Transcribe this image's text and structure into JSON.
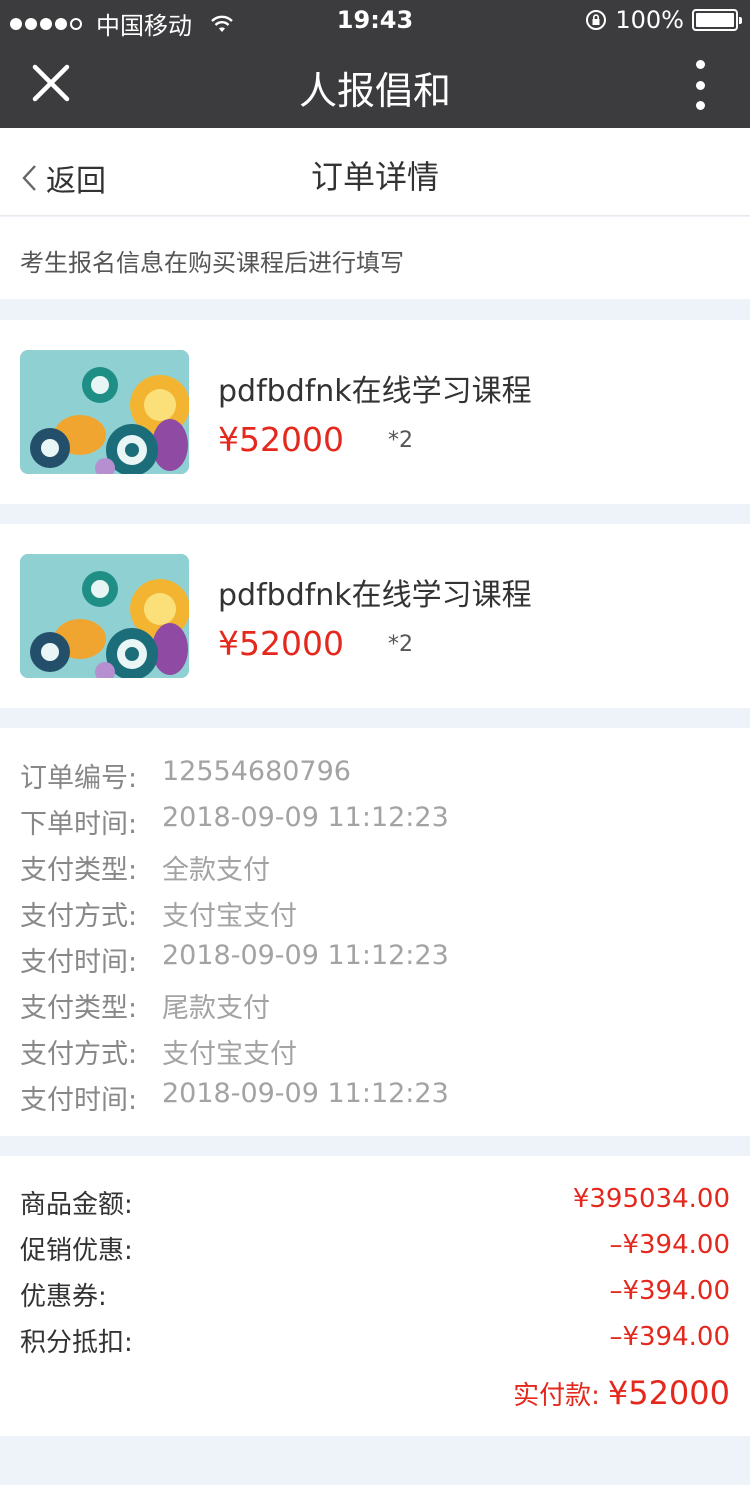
{
  "status_bar": {
    "carrier": "中国移动",
    "time": "19:43",
    "battery": "100%",
    "signal_bars_filled": 4,
    "signal_bars_total": 5
  },
  "title_bar": {
    "title": "人报倡和",
    "close_icon": "close-icon",
    "more_icon": "more-vertical-icon"
  },
  "nav": {
    "back_label": "返回",
    "page_title": "订单详情"
  },
  "notice": "考生报名信息在购买课程后进行填写",
  "products": [
    {
      "name": "pdfbdfnk在线学习课程",
      "price": "¥52000",
      "qty": "*2"
    },
    {
      "name": "pdfbdfnk在线学习课程",
      "price": "¥52000",
      "qty": "*2"
    }
  ],
  "order_info": [
    {
      "label": "订单编号:",
      "value": "12554680796"
    },
    {
      "label": "下单时间:",
      "value": "2018-09-09 11:12:23"
    },
    {
      "label": "支付类型:",
      "value": "全款支付"
    },
    {
      "label": "支付方式:",
      "value": "支付宝支付"
    },
    {
      "label": "支付时间:",
      "value": "2018-09-09 11:12:23"
    },
    {
      "label": "支付类型:",
      "value": "尾款支付"
    },
    {
      "label": "支付方式:",
      "value": "支付宝支付"
    },
    {
      "label": "支付时间:",
      "value": "2018-09-09 11:12:23"
    }
  ],
  "summary": {
    "lines": [
      {
        "label": "商品金额:",
        "amount": "¥395034.00"
      },
      {
        "label": "促销优惠:",
        "amount": "–¥394.00"
      },
      {
        "label": "优惠券:",
        "amount": "–¥394.00"
      },
      {
        "label": "积分抵扣:",
        "amount": "–¥394.00"
      }
    ],
    "total_label": "实付款:",
    "total_value": "¥52000"
  },
  "colors": {
    "header_bg": "#3c3c3e",
    "accent_red": "#e4281d",
    "page_bg": "#eef3fa"
  }
}
